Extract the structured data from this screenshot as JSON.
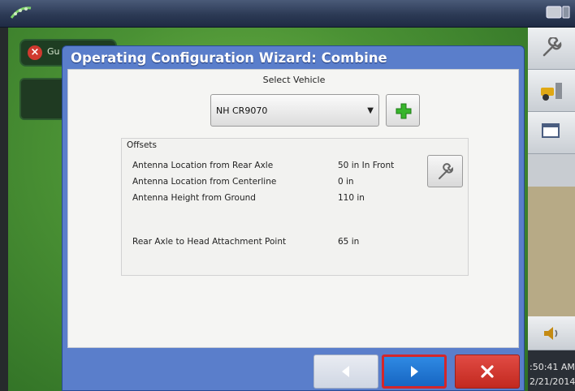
{
  "guidance": {
    "label": "Gu"
  },
  "dialog": {
    "title": "Operating Configuration Wizard:  Combine",
    "select_vehicle_label": "Select Vehicle",
    "vehicle": {
      "selected": "NH CR9070"
    },
    "offsets": {
      "title": "Offsets",
      "rows": [
        {
          "label": "Antenna Location from Rear Axle",
          "value": "50 in In Front"
        },
        {
          "label": "Antenna Location from Centerline",
          "value": "0 in"
        },
        {
          "label": "Antenna Height from Ground",
          "value": "110 in"
        },
        {
          "label": "Rear Axle to Head Attachment Point",
          "value": "65 in"
        }
      ]
    }
  },
  "clock": {
    "time": ":50:41 AM",
    "date": "2/21/2014"
  },
  "colors": {
    "accent_blue": "#5a7ecb",
    "next_button": "#1f79d6",
    "cancel_button": "#d23a32",
    "highlight_border": "#d4262a",
    "field_green": "#4a9134"
  },
  "icons": [
    "gps-satellite-icon",
    "monitor-icon",
    "wrench-icon",
    "implement-icon",
    "window-icon",
    "volume-icon",
    "add-plus-icon",
    "back-arrow-icon",
    "next-arrow-icon",
    "close-x-icon"
  ]
}
